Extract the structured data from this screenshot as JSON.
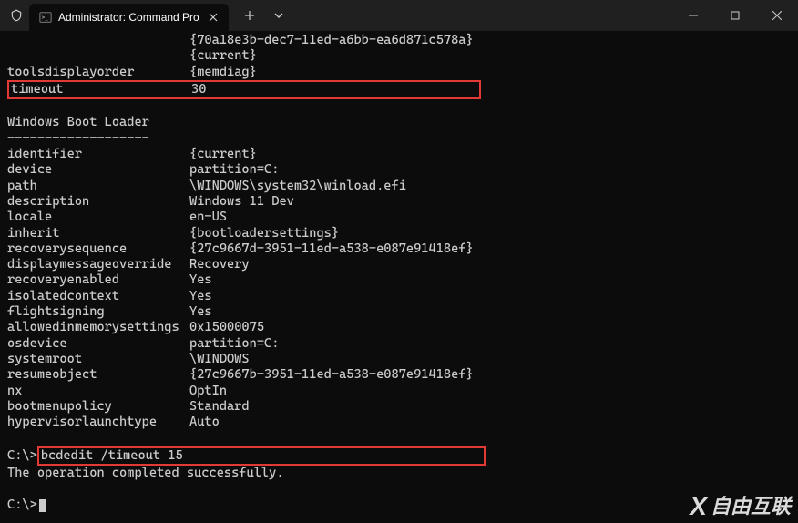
{
  "titlebar": {
    "tab_title": "Administrator: Command Pro"
  },
  "pre_lines": {
    "guid1": "{70a18e3b-dec7-11ed-a6bb-ea6d871c578a}",
    "cur": "{current}",
    "tools_key": "toolsdisplayorder",
    "tools_val": "{memdiag}"
  },
  "timeout_row": {
    "key": "timeout",
    "val": "30"
  },
  "section_title": "Windows Boot Loader",
  "section_divider": "-------------------",
  "props": [
    {
      "key": "identifier",
      "val": "{current}"
    },
    {
      "key": "device",
      "val": "partition=C:"
    },
    {
      "key": "path",
      "val": "\\WINDOWS\\system32\\winload.efi"
    },
    {
      "key": "description",
      "val": "Windows 11 Dev"
    },
    {
      "key": "locale",
      "val": "en-US"
    },
    {
      "key": "inherit",
      "val": "{bootloadersettings}"
    },
    {
      "key": "recoverysequence",
      "val": "{27c9667d-3951-11ed-a538-e087e91418ef}"
    },
    {
      "key": "displaymessageoverride",
      "val": "Recovery"
    },
    {
      "key": "recoveryenabled",
      "val": "Yes"
    },
    {
      "key": "isolatedcontext",
      "val": "Yes"
    },
    {
      "key": "flightsigning",
      "val": "Yes"
    },
    {
      "key": "allowedinmemorysettings",
      "val": "0x15000075"
    },
    {
      "key": "osdevice",
      "val": "partition=C:"
    },
    {
      "key": "systemroot",
      "val": "\\WINDOWS"
    },
    {
      "key": "resumeobject",
      "val": "{27c9667b-3951-11ed-a538-e087e91418ef}"
    },
    {
      "key": "nx",
      "val": "OptIn"
    },
    {
      "key": "bootmenupolicy",
      "val": "Standard"
    },
    {
      "key": "hypervisorlaunchtype",
      "val": "Auto"
    }
  ],
  "cmd": {
    "prompt1_pre": "C:\\>",
    "cmd_text": "bcdedit /timeout 15",
    "result": "The operation completed successfully.",
    "prompt2": "C:\\>"
  },
  "watermark": "自由互联"
}
